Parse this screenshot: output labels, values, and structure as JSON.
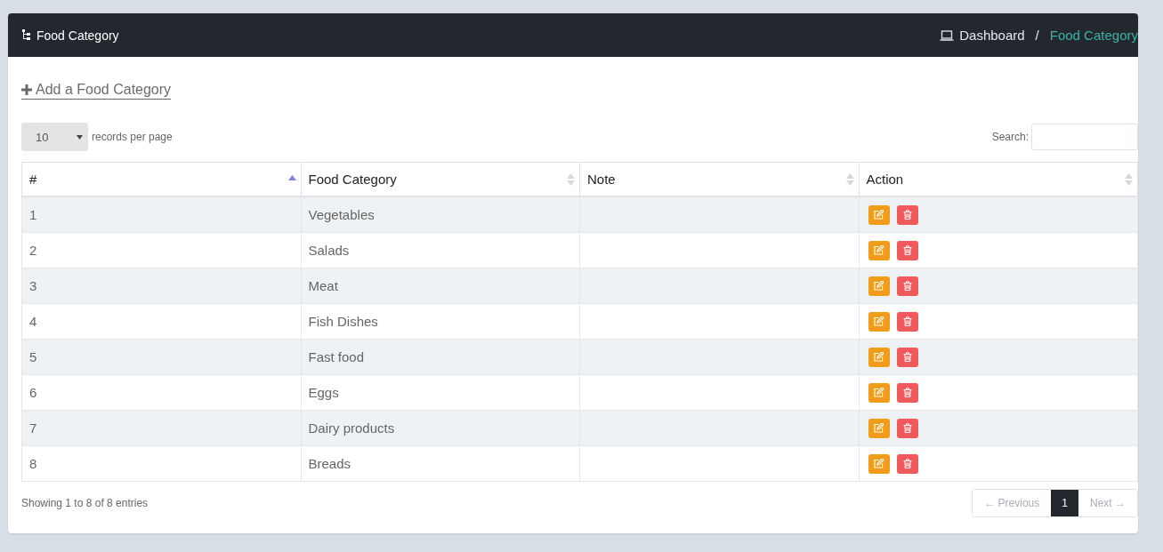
{
  "header": {
    "title": "Food Category",
    "breadcrumb": [
      {
        "label": "Dashboard",
        "selected": false
      },
      {
        "label": "Food Category",
        "selected": true
      }
    ],
    "separator": "/"
  },
  "add_link": "Add a Food Category",
  "length_select": {
    "value": "10",
    "label": "records per page"
  },
  "search": {
    "label": "Search:"
  },
  "table": {
    "columns": [
      {
        "label": "#",
        "sorted": true
      },
      {
        "label": "Food Category",
        "sorted": false
      },
      {
        "label": "Note",
        "sorted": false
      },
      {
        "label": "Action",
        "sorted": false
      }
    ],
    "rows": [
      {
        "id": "1",
        "name": "Vegetables"
      },
      {
        "id": "2",
        "name": "Salads"
      },
      {
        "id": "3",
        "name": "Meat"
      },
      {
        "id": "4",
        "name": "Fish Dishes"
      },
      {
        "id": "5",
        "name": "Fast food"
      },
      {
        "id": "6",
        "name": "Eggs"
      },
      {
        "id": "7",
        "name": "Dairy products"
      },
      {
        "id": "8",
        "name": "Breads"
      }
    ]
  },
  "info": "Showing 1 to 8 of 8 entries",
  "pagination": [
    {
      "label": "← Previous",
      "kind": "nav",
      "disabled": true,
      "selected": false
    },
    {
      "label": "1",
      "kind": "page",
      "disabled": false,
      "selected": true
    },
    {
      "label": "Next →",
      "kind": "nav",
      "disabled": true,
      "selected": false
    }
  ]
}
